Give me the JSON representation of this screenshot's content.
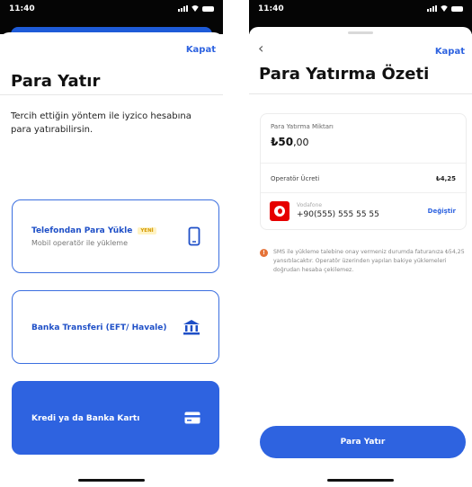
{
  "left_screen": {
    "status_time": "11:40",
    "close_label": "Kapat",
    "title": "Para Yatır",
    "description": "Tercih ettiğin yöntem ile iyzico hesabına para yatırabilirsin.",
    "options": [
      {
        "title": "Telefondan Para Yükle",
        "badge": "YENİ",
        "subtitle": "Mobil operatör ile yükleme",
        "icon": "phone-icon"
      },
      {
        "title": "Banka Transferi (EFT/ Havale)",
        "icon": "bank-icon"
      },
      {
        "title": "Kredi ya da Banka Kartı",
        "icon": "card-icon"
      }
    ]
  },
  "right_screen": {
    "status_time": "11:40",
    "close_label": "Kapat",
    "title": "Para Yatırma Özeti",
    "amount_label": "Para Yatırma Miktarı",
    "amount_main": "₺50",
    "amount_decimal": ",00",
    "fee_label": "Operatör Ücreti",
    "fee_value": "₺4,25",
    "operator_name": "Vodafone",
    "operator_number": "+90(555) 555 55 55",
    "change_label": "Değiştir",
    "warning_text": "SMS ile yükleme talebine onay vermeniz durumda faturanıza ₺54,25 yansıtılacaktır. Operatör üzerinden yapılan bakiye yüklemeleri doğrudan hesaba çekilemez.",
    "submit_label": "Para Yatır"
  },
  "colors": {
    "accent": "#2e63e0",
    "vodafone": "#e60000",
    "badge_bg": "#fff3c4",
    "warning": "#e57339"
  }
}
